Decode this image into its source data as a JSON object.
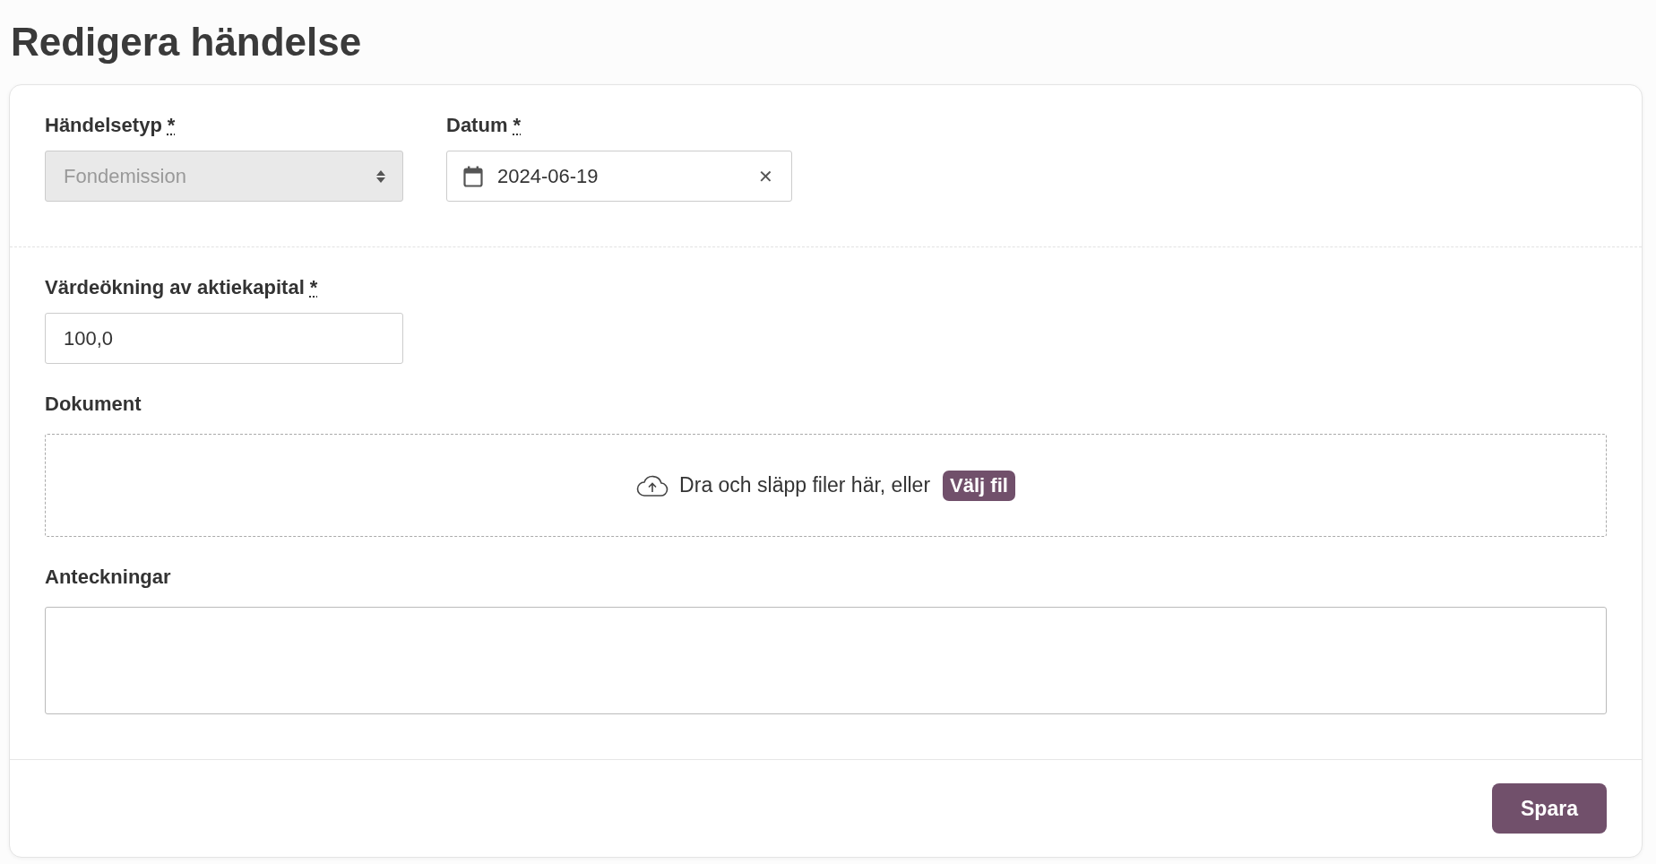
{
  "page_title": "Redigera händelse",
  "header_fields": [
    {
      "kind": "select",
      "label": "Händelsetyp",
      "required_mark": "*",
      "value": "Fondemission",
      "disabled": true
    },
    {
      "kind": "date",
      "label": "Datum",
      "required_mark": "*",
      "value": "2024-06-19",
      "clear": "✕"
    }
  ],
  "capital_field": {
    "label": "Värdeökning av aktiekapital",
    "required_mark": "*",
    "value": "100,0"
  },
  "documents": {
    "label": "Dokument",
    "prompt": "Dra och släpp filer här, eller",
    "choose_button": "Välj fil"
  },
  "notes": {
    "label": "Anteckningar"
  },
  "save_button": "Spara"
}
